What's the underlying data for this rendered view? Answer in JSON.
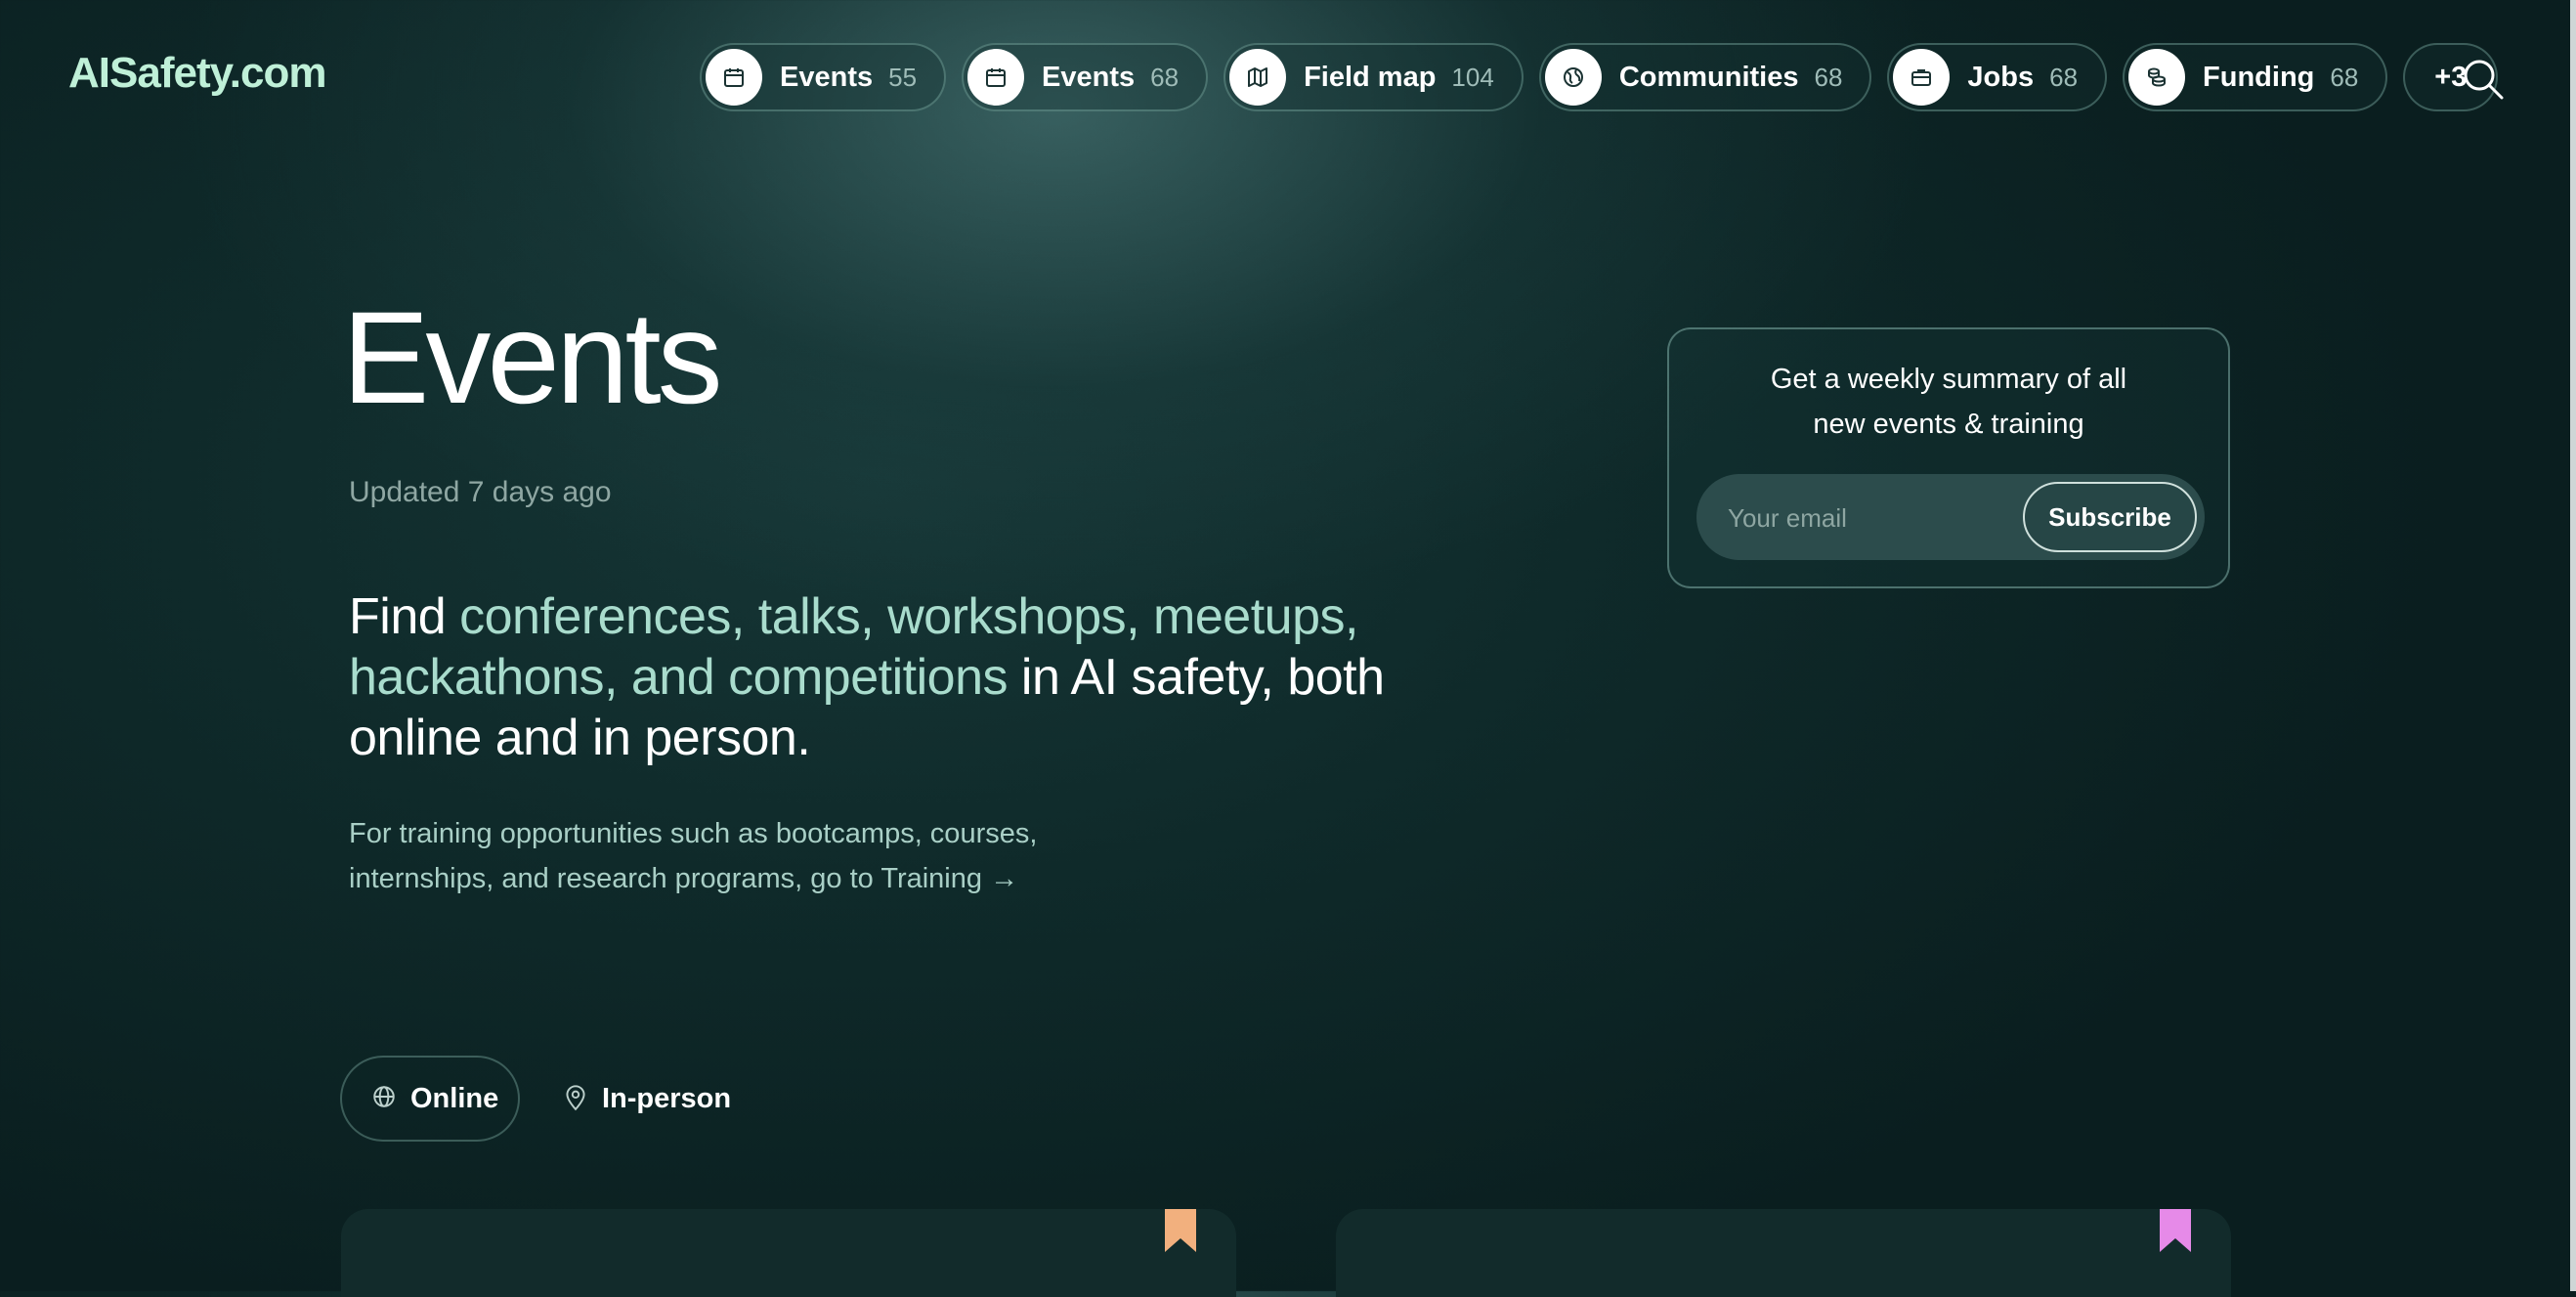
{
  "logo": "AISafety.com",
  "nav": [
    {
      "icon": "calendar-icon",
      "label": "Events",
      "count": "55"
    },
    {
      "icon": "calendar-icon",
      "label": "Events",
      "count": "68"
    },
    {
      "icon": "map-icon",
      "label": "Field map",
      "count": "104"
    },
    {
      "icon": "globe-icon",
      "label": "Communities",
      "count": "68"
    },
    {
      "icon": "briefcase-icon",
      "label": "Jobs",
      "count": "68"
    },
    {
      "icon": "coins-icon",
      "label": "Funding",
      "count": "68"
    }
  ],
  "nav_more": "+3",
  "page": {
    "title": "Events",
    "updated": "Updated 7 days ago",
    "lead_start": "Find ",
    "lead_highlight": "conferences, talks, workshops, meetups, hackathons, and competitions",
    "lead_end": " in AI safety, both online and in person.",
    "training_text": "For training opportunities such as bootcamps, courses, internships, and research programs, go to Training →"
  },
  "subscribe_card": {
    "line1": "Get a weekly summary of all",
    "line2": "new events & training",
    "email_placeholder": "Your email",
    "button": "Subscribe"
  },
  "filters": {
    "online": "Online",
    "in_person": "In-person"
  },
  "colors": {
    "accent": "#a9dccd",
    "bookmark_left": "#f2b07e",
    "bookmark_right": "#e68ae8"
  }
}
